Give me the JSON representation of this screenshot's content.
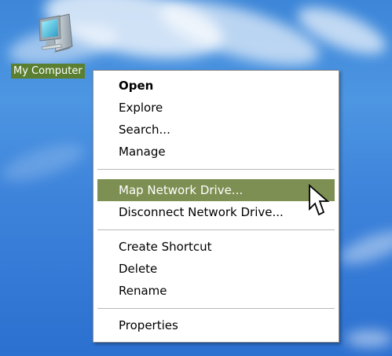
{
  "desktop": {
    "icon": {
      "label": "My Computer",
      "icon_name": "computer-icon"
    }
  },
  "context_menu": {
    "items": [
      {
        "label": "Open",
        "style": "default"
      },
      {
        "label": "Explore"
      },
      {
        "label": "Search..."
      },
      {
        "label": "Manage"
      },
      {
        "label": "Map Network Drive...",
        "state": "highlighted"
      },
      {
        "label": "Disconnect Network Drive..."
      },
      {
        "label": "Create Shortcut"
      },
      {
        "label": "Delete"
      },
      {
        "label": "Rename"
      },
      {
        "label": "Properties"
      }
    ]
  },
  "cursor": {
    "icon_name": "arrow-cursor-icon"
  },
  "colors": {
    "desktop_blue": "#3d86d8",
    "menu_background": "#ffffff",
    "menu_highlight": "#7d8f52",
    "icon_label_highlight": "#5b7f31"
  }
}
